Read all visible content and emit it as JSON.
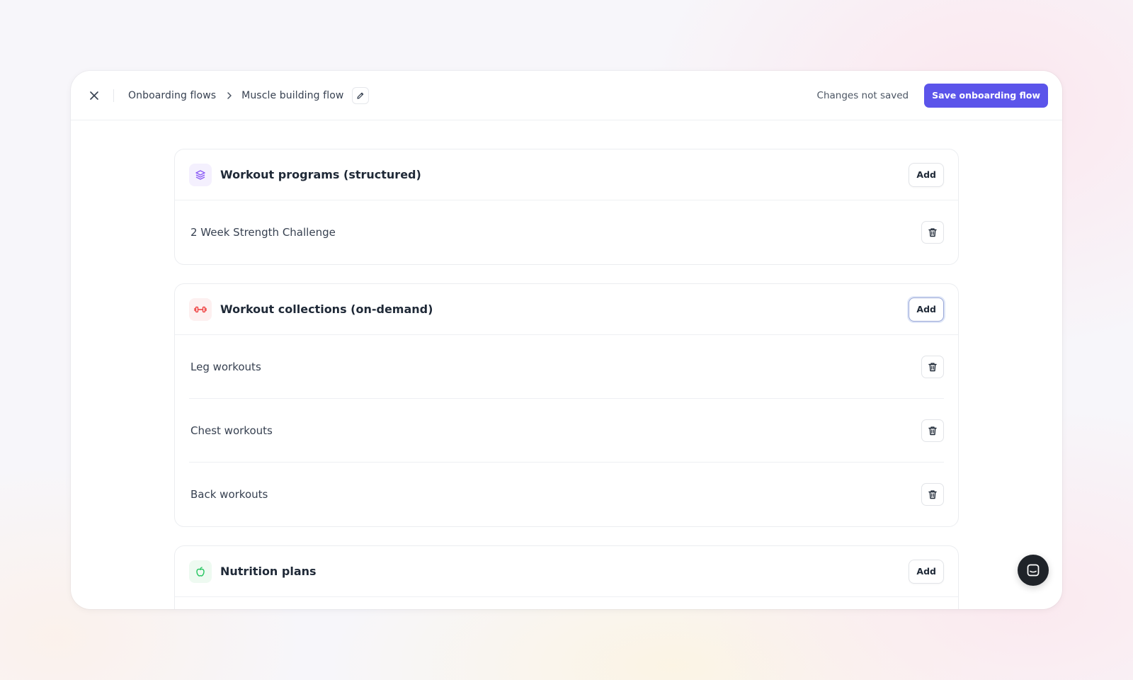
{
  "header": {
    "close_icon": "close-icon",
    "breadcrumb": {
      "parent": "Onboarding flows",
      "separator_icon": "chevron-right-icon",
      "current": "Muscle building flow",
      "edit_icon": "pencil-icon"
    },
    "status": "Changes not saved",
    "save_label": "Save onboarding flow",
    "accent_color": "#5b54ea"
  },
  "sections": [
    {
      "title": "Workout programs (structured)",
      "icon": "layers-icon",
      "icon_color": "#8b5cf6",
      "add_label": "Add",
      "items": [
        {
          "label": "2 Week Strength Challenge",
          "action_icon": "trash-icon"
        }
      ]
    },
    {
      "title": "Workout collections (on-demand)",
      "icon": "dumbbell-icon",
      "icon_color": "#ef4444",
      "add_label": "Add",
      "items": [
        {
          "label": "Leg workouts",
          "action_icon": "trash-icon"
        },
        {
          "label": "Chest workouts",
          "action_icon": "trash-icon"
        },
        {
          "label": "Back workouts",
          "action_icon": "trash-icon"
        }
      ]
    },
    {
      "title": "Nutrition plans",
      "icon": "apple-icon",
      "icon_color": "#22c55e",
      "add_label": "Add",
      "items": []
    }
  ],
  "chat": {
    "icon": "chat-icon"
  }
}
